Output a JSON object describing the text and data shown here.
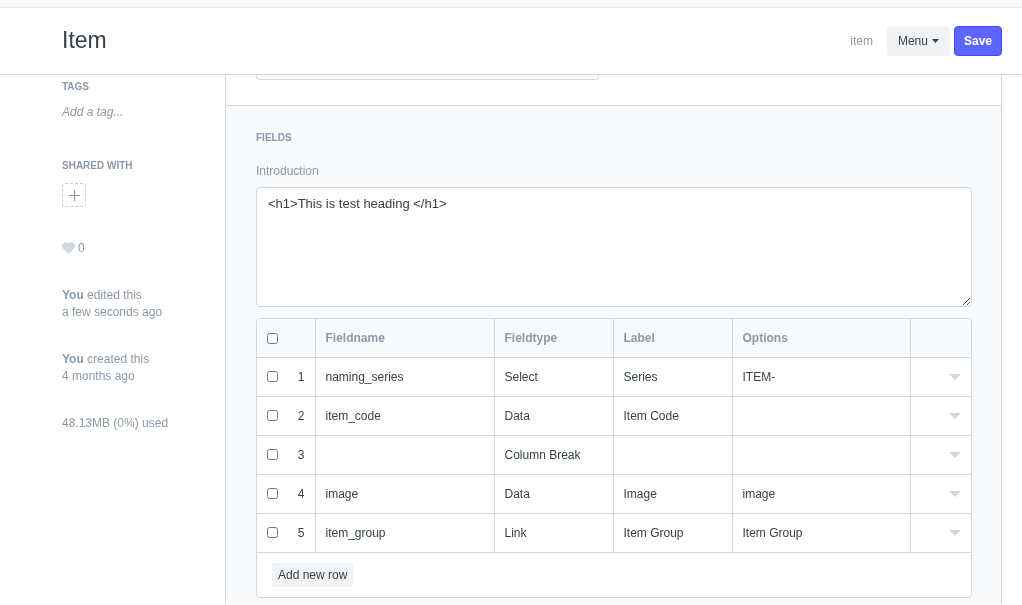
{
  "header": {
    "title": "Item",
    "doctype": "item",
    "menu_button": "Menu",
    "save_button": "Save"
  },
  "sidebar": {
    "tags_label": "TAGS",
    "tag_placeholder": "Add a tag...",
    "shared_label": "SHARED WITH",
    "likes": "0",
    "activity": [
      {
        "text": "**You** edited this",
        "time": "a few seconds ago"
      },
      {
        "text": "**You** created this",
        "time": "4 months ago"
      }
    ],
    "storage": "48.13MB (0%) used"
  },
  "section": {
    "title": "FIELDS",
    "field_label": "Introduction",
    "field_value": "<h1>This is test heading </h1>",
    "table": {
      "columns": [
        "Fieldname",
        "Fieldtype",
        "Label",
        "Options"
      ],
      "all_checked": false,
      "rows": [
        {
          "index": "1",
          "checked": false,
          "cells": [
            "naming_series",
            "Select",
            "Series",
            "ITEM-"
          ]
        },
        {
          "index": "2",
          "checked": false,
          "cells": [
            "item_code",
            "Data",
            "Item Code",
            ""
          ]
        },
        {
          "index": "3",
          "checked": false,
          "cells": [
            "",
            "Column Break",
            "",
            ""
          ]
        },
        {
          "index": "4",
          "checked": false,
          "cells": [
            "image",
            "Data",
            "Image",
            "image"
          ]
        },
        {
          "index": "5",
          "checked": false,
          "cells": [
            "item_group",
            "Link",
            "Item Group",
            "Item Group"
          ]
        }
      ],
      "add_row_button": "Add new row"
    }
  }
}
